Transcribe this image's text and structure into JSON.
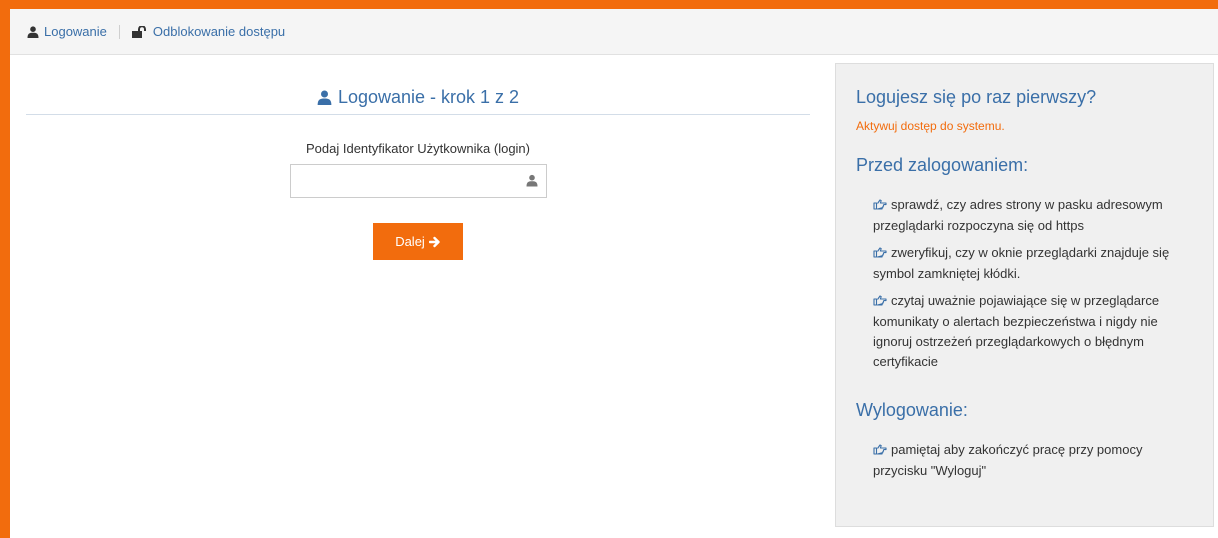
{
  "nav": {
    "login_label": "Logowanie",
    "unlock_label": "Odblokowanie dostępu"
  },
  "login": {
    "title": "Logowanie - krok 1 z 2",
    "field_label": "Podaj Identyfikator Użytkownika (login)",
    "login_value": "",
    "next_label": "Dalej"
  },
  "panel": {
    "first_time_heading": "Logujesz się po raz pierwszy?",
    "activate_link": "Aktywuj dostęp do systemu.",
    "before_heading": "Przed zalogowaniem:",
    "tips": [
      "sprawdź, czy adres strony w pasku adresowym przeglądarki rozpoczyna się od https",
      "zweryfikuj, czy w oknie przeglądarki znajduje się symbol zamkniętej kłódki.",
      "czytaj uważnie pojawiające się w przeglądarce komunikaty o alertach bezpieczeństwa i nigdy nie ignoruj ostrzeżeń przeglądarkowych o błędnym certyfikacie"
    ],
    "logout_heading": "Wylogowanie:",
    "logout_tips": [
      "pamiętaj aby zakończyć pracę przy pomocy przycisku \"Wyloguj\""
    ]
  },
  "colors": {
    "accent": "#f26c0d",
    "link": "#3a6fa8",
    "panel_bg": "#f0f0f0"
  },
  "icons": {
    "nav_login": "user-icon",
    "nav_unlock": "unlock-icon",
    "title": "user-icon",
    "input": "user-icon",
    "button": "arrow-right-icon",
    "tip": "hand-point-right-icon"
  }
}
